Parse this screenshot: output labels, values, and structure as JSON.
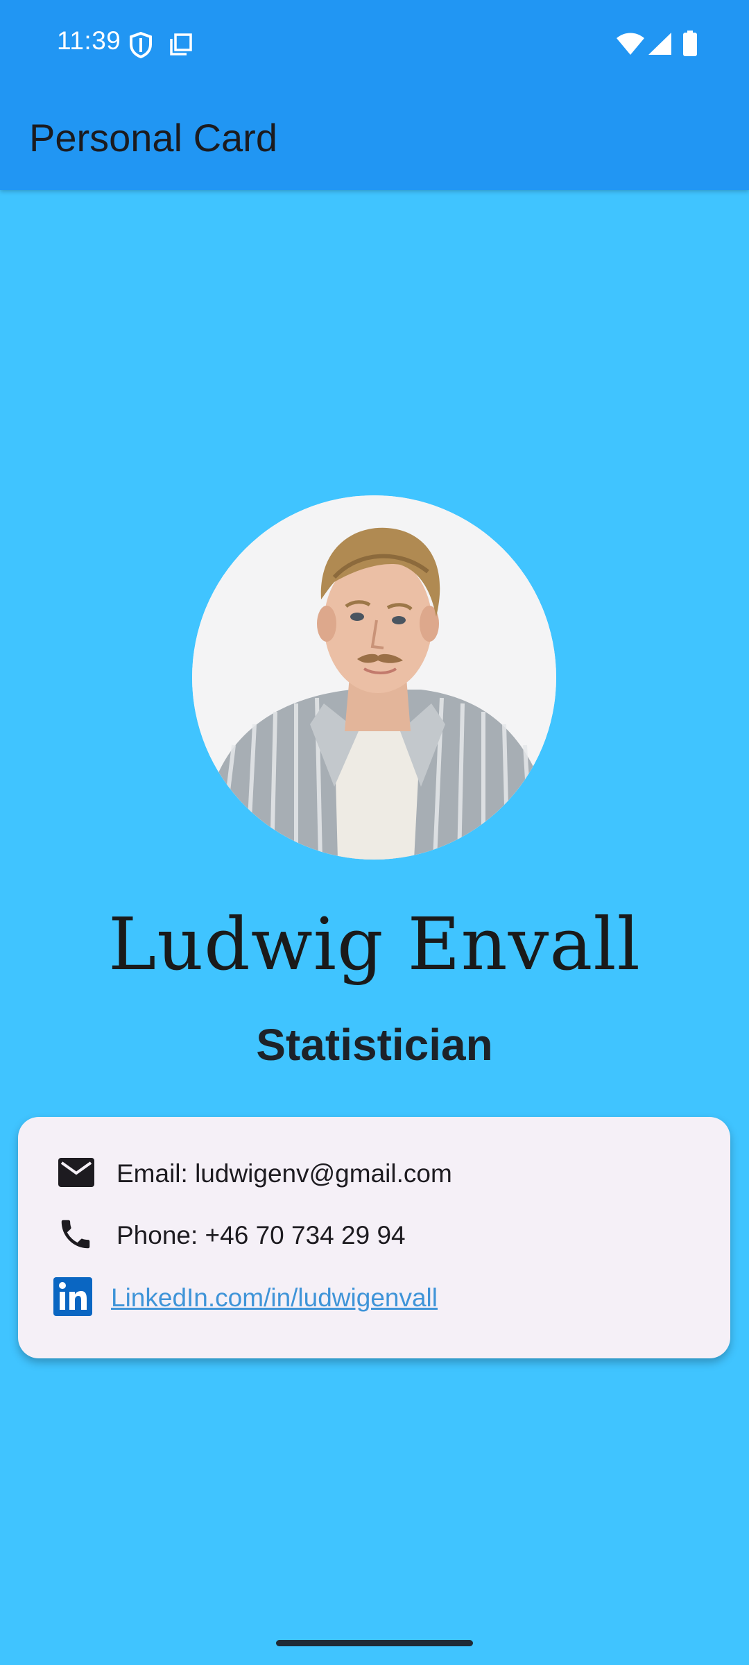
{
  "status_bar": {
    "time": "11:39",
    "icons": [
      "shield-icon",
      "screenshot-icon",
      "wifi-icon",
      "signal-icon",
      "battery-icon"
    ]
  },
  "app_bar": {
    "title": "Personal Card",
    "color": "#2196F3"
  },
  "profile": {
    "name": "Ludwig Envall",
    "title": "Statistician",
    "avatar": "profile-photo"
  },
  "contact": {
    "email_text": "Email: ludwigenv@gmail.com",
    "phone_text": "Phone: +46 70 734 29 94",
    "linkedin_text": "LinkedIn.com/in/ludwigenvall",
    "icons": [
      "email-icon",
      "phone-icon",
      "linkedin-icon"
    ],
    "link_color": "#3f94d8"
  },
  "colors": {
    "background": "#40C4FF",
    "card": "#f5f0f7"
  }
}
